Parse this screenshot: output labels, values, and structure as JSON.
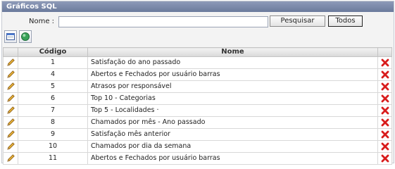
{
  "window": {
    "title": "Gráficos SQL"
  },
  "search": {
    "label": "Nome :",
    "value": "",
    "placeholder": ""
  },
  "buttons": {
    "search": "Pesquisar",
    "all": "Todos"
  },
  "toolbar": {
    "icons": [
      "new-window-icon",
      "refresh-globe-icon"
    ]
  },
  "table": {
    "columns": [
      "Código",
      "Nome"
    ],
    "rows": [
      {
        "code": "1",
        "name": "Satisfação do ano passado"
      },
      {
        "code": "4",
        "name": "Abertos e Fechados por usuário barras"
      },
      {
        "code": "5",
        "name": "Atrasos por responsável"
      },
      {
        "code": "6",
        "name": "Top 10 - Categorias"
      },
      {
        "code": "7",
        "name": "Top 5 - Localidades ·"
      },
      {
        "code": "8",
        "name": "Chamados por mês - Ano passado"
      },
      {
        "code": "9",
        "name": "Satisfação mês anterior"
      },
      {
        "code": "10",
        "name": "Chamados por dia da semana"
      },
      {
        "code": "11",
        "name": "Abertos e Fechados por usuário barras"
      }
    ]
  },
  "colors": {
    "title_bar": "#7584a6",
    "delete": "#d81c1c",
    "edit": "#e0a82e"
  }
}
